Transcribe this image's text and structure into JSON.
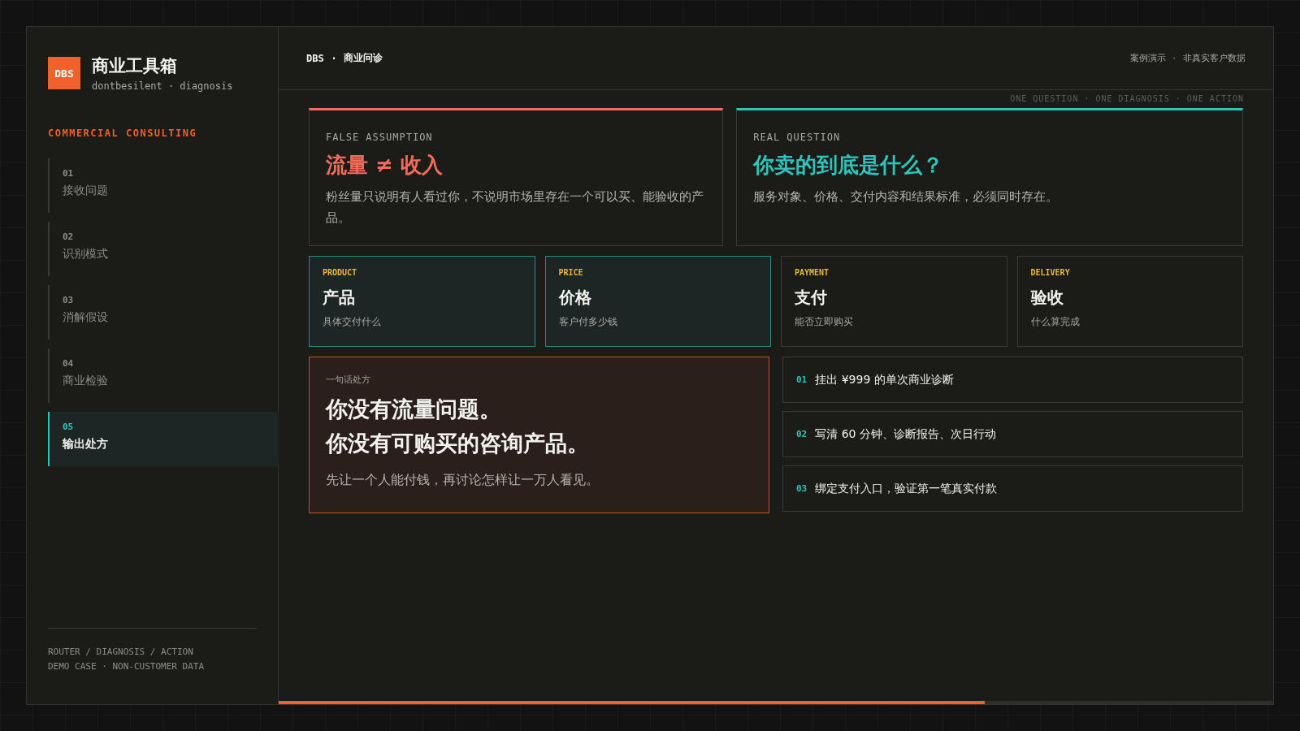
{
  "sidebar": {
    "logo": "DBS",
    "title": "商业工具箱",
    "subtitle": "dontbesilent · diagnosis",
    "section": "COMMERCIAL CONSULTING",
    "steps": [
      {
        "number": "01",
        "label": "接收问题",
        "selected": false
      },
      {
        "number": "02",
        "label": "识别模式",
        "selected": false
      },
      {
        "number": "03",
        "label": "消解假设",
        "selected": false
      },
      {
        "number": "04",
        "label": "商业检验",
        "selected": false
      },
      {
        "number": "05",
        "label": "输出处方",
        "selected": true
      }
    ],
    "footer": [
      "ROUTER / DIAGNOSIS / ACTION",
      "DEMO CASE · NON-CUSTOMER DATA"
    ]
  },
  "header": {
    "brand": "DBS",
    "separator": "·",
    "title": "商业问诊",
    "note": "案例演示",
    "note_separator": "·",
    "note_2": "非真实客户数据"
  },
  "tagline": "ONE QUESTION · ONE DIAGNOSIS · ONE ACTION",
  "insights": [
    {
      "label": "FALSE ASSUMPTION",
      "headline": "流量 ≠ 收入",
      "body": "粉丝量只说明有人看过你，不说明市场里存在一个可以买、能验收的产品。",
      "color": "#f26b5b"
    },
    {
      "label": "REAL QUESTION",
      "headline": "你卖的到底是什么？",
      "body": "服务对象、价格、交付内容和结果标准，必须同时存在。",
      "color": "#2fc4bb"
    }
  ],
  "pillars": [
    {
      "label": "PRODUCT",
      "title": "产品",
      "desc": "具体交付什么",
      "highlighted": true
    },
    {
      "label": "PRICE",
      "title": "价格",
      "desc": "客户付多少钱",
      "highlighted": true
    },
    {
      "label": "PAYMENT",
      "title": "支付",
      "desc": "能否立即购买",
      "highlighted": false
    },
    {
      "label": "DELIVERY",
      "title": "验收",
      "desc": "什么算完成",
      "highlighted": false
    }
  ],
  "prescription": {
    "label": "一句话处方",
    "lines": [
      "你没有流量问题。",
      "你没有可购买的咨询产品。"
    ],
    "body": "先让一个人能付钱，再讨论怎样让一万人看见。"
  },
  "actions": [
    {
      "number": "01",
      "text": "挂出 ¥999 的单次商业诊断"
    },
    {
      "number": "02",
      "text": "写清 60 分钟、诊断报告、次日行动"
    },
    {
      "number": "03",
      "text": "绑定支付入口，验证第一笔真实付款"
    }
  ],
  "progress": {
    "level": 0.71
  }
}
